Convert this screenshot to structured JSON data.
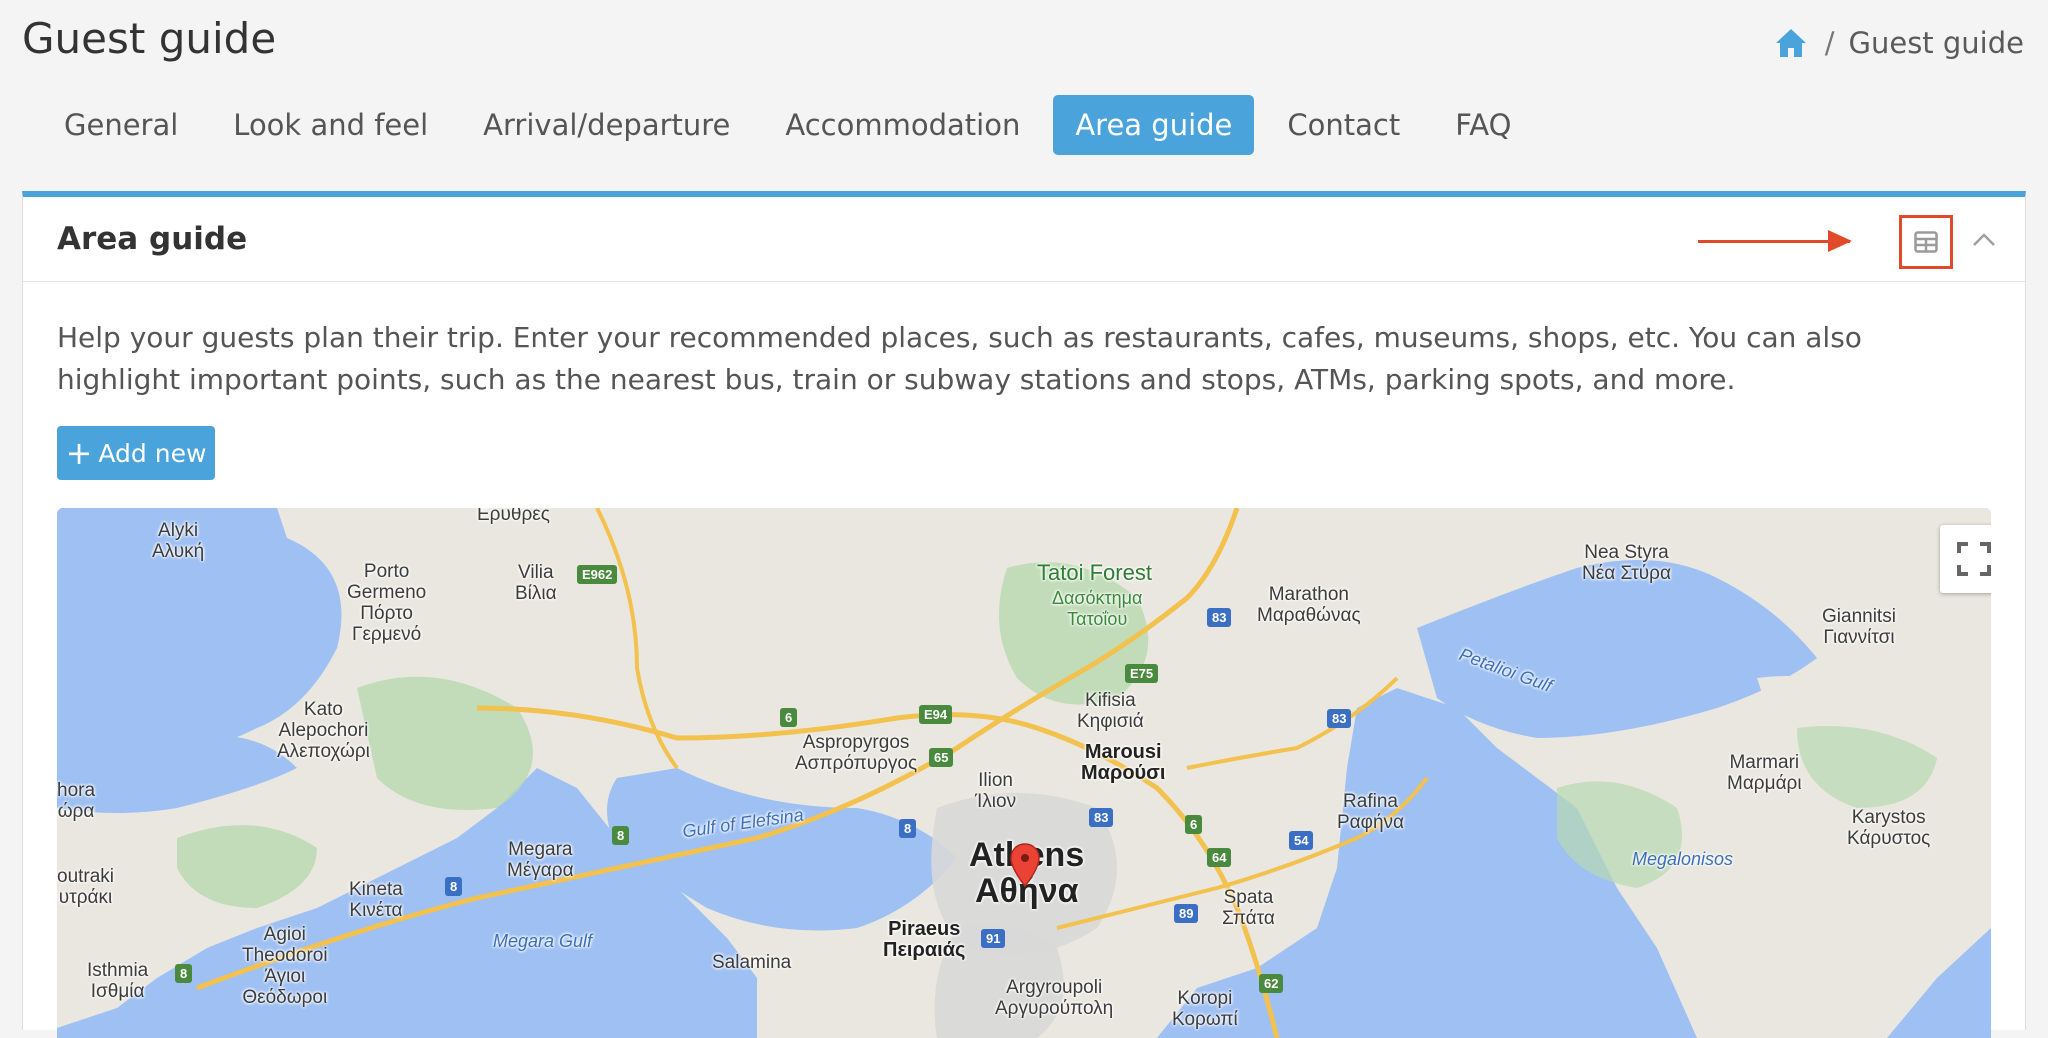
{
  "page": {
    "title": "Guest guide"
  },
  "breadcrumb": {
    "current": "Guest guide",
    "separator": "/"
  },
  "tabs": [
    {
      "label": "General",
      "active": false
    },
    {
      "label": "Look and feel",
      "active": false
    },
    {
      "label": "Arrival/departure",
      "active": false
    },
    {
      "label": "Accommodation",
      "active": false
    },
    {
      "label": "Area guide",
      "active": true
    },
    {
      "label": "Contact",
      "active": false
    },
    {
      "label": "FAQ",
      "active": false
    }
  ],
  "panel": {
    "title": "Area guide",
    "description": "Help your guests plan their trip. Enter your recommended places, such as restaurants, cafes, museums, shops, etc. You can also highlight important points, such as the nearest bus, train or subway stations and stops, ATMs, parking spots, and more.",
    "add_button": "Add new",
    "header_icons": [
      "table-view-icon",
      "chevron-up-icon"
    ]
  },
  "map": {
    "city": {
      "en": "Athens",
      "el": "Αθήνα"
    },
    "labels": {
      "erythres": "Ερυθρές",
      "alyki": "Alyki\nΑλυκή",
      "porto_germeno": "Porto\nGermeno\nΠόρτο\nΓερμενό",
      "vilia": "Vilia\nΒίλια",
      "tatoi_forest": "Tatoi Forest",
      "tatoi_forest_el": "Δασόκτημα\nΤατοΐου",
      "marathon": "Marathon\nΜαραθώνας",
      "nea_styra": "Nea Styra\nΝέα Στύρα",
      "giannitsi": "Giannitsi\nΓιαννίτσι",
      "petalioi_gulf": "Petalioi Gulf",
      "kato_alepochori": "Kato\nAlepochori\nΑλεποχώρι",
      "aspropyrgos": "Aspropyrgos\nΑσπρόπυργος",
      "kifisia": "Kifisia\nΚηφισιά",
      "marousi": "Marousi\nΜαρούσι",
      "ilion": "Ilion\nΊλιον",
      "gulf_of_elefsina": "Gulf of Elefsina",
      "rafina": "Rafina\nΡαφήνα",
      "marmari": "Marmari\nΜαρμάρι",
      "karystos": "Karystos\nΚάρυστος",
      "megalonisos": "Megalonisos",
      "chora": "hora\nώρα",
      "megara": "Megara\nΜέγαρα",
      "loutraki": "outraki\nυτράκι",
      "kineta": "Kineta\nΚινέτα",
      "megara_gulf": "Megara Gulf",
      "agioi_theodoroi": "Agioi\nTheodoroi\nΆγιοι\nΘεόδωροι",
      "isthmia": "Isthmia\nΙσθμία",
      "salamina": "Salamina",
      "piraeus": "Piraeus\nΠειραιάς",
      "spata": "Spata\nΣπάτα",
      "argyroupoli": "Argyroupoli\nΑργυρούπολη",
      "koropi": "Koropi\nΚορωπί"
    },
    "road_shields": {
      "e962": "E962",
      "e75": "E75",
      "e94": "E94",
      "r83a": "83",
      "r83b": "83",
      "r83c": "83",
      "r6a": "6",
      "r6b": "6",
      "r65": "65",
      "r8a": "8",
      "r8b": "8",
      "r8c": "8",
      "r8d": "8",
      "r64": "64",
      "r54": "54",
      "r89": "89",
      "r91": "91",
      "r62": "62"
    },
    "icons": [
      "fullscreen-icon",
      "map-pin-icon"
    ]
  },
  "colors": {
    "accent": "#4aa3da",
    "annotation": "#e04a2a"
  }
}
